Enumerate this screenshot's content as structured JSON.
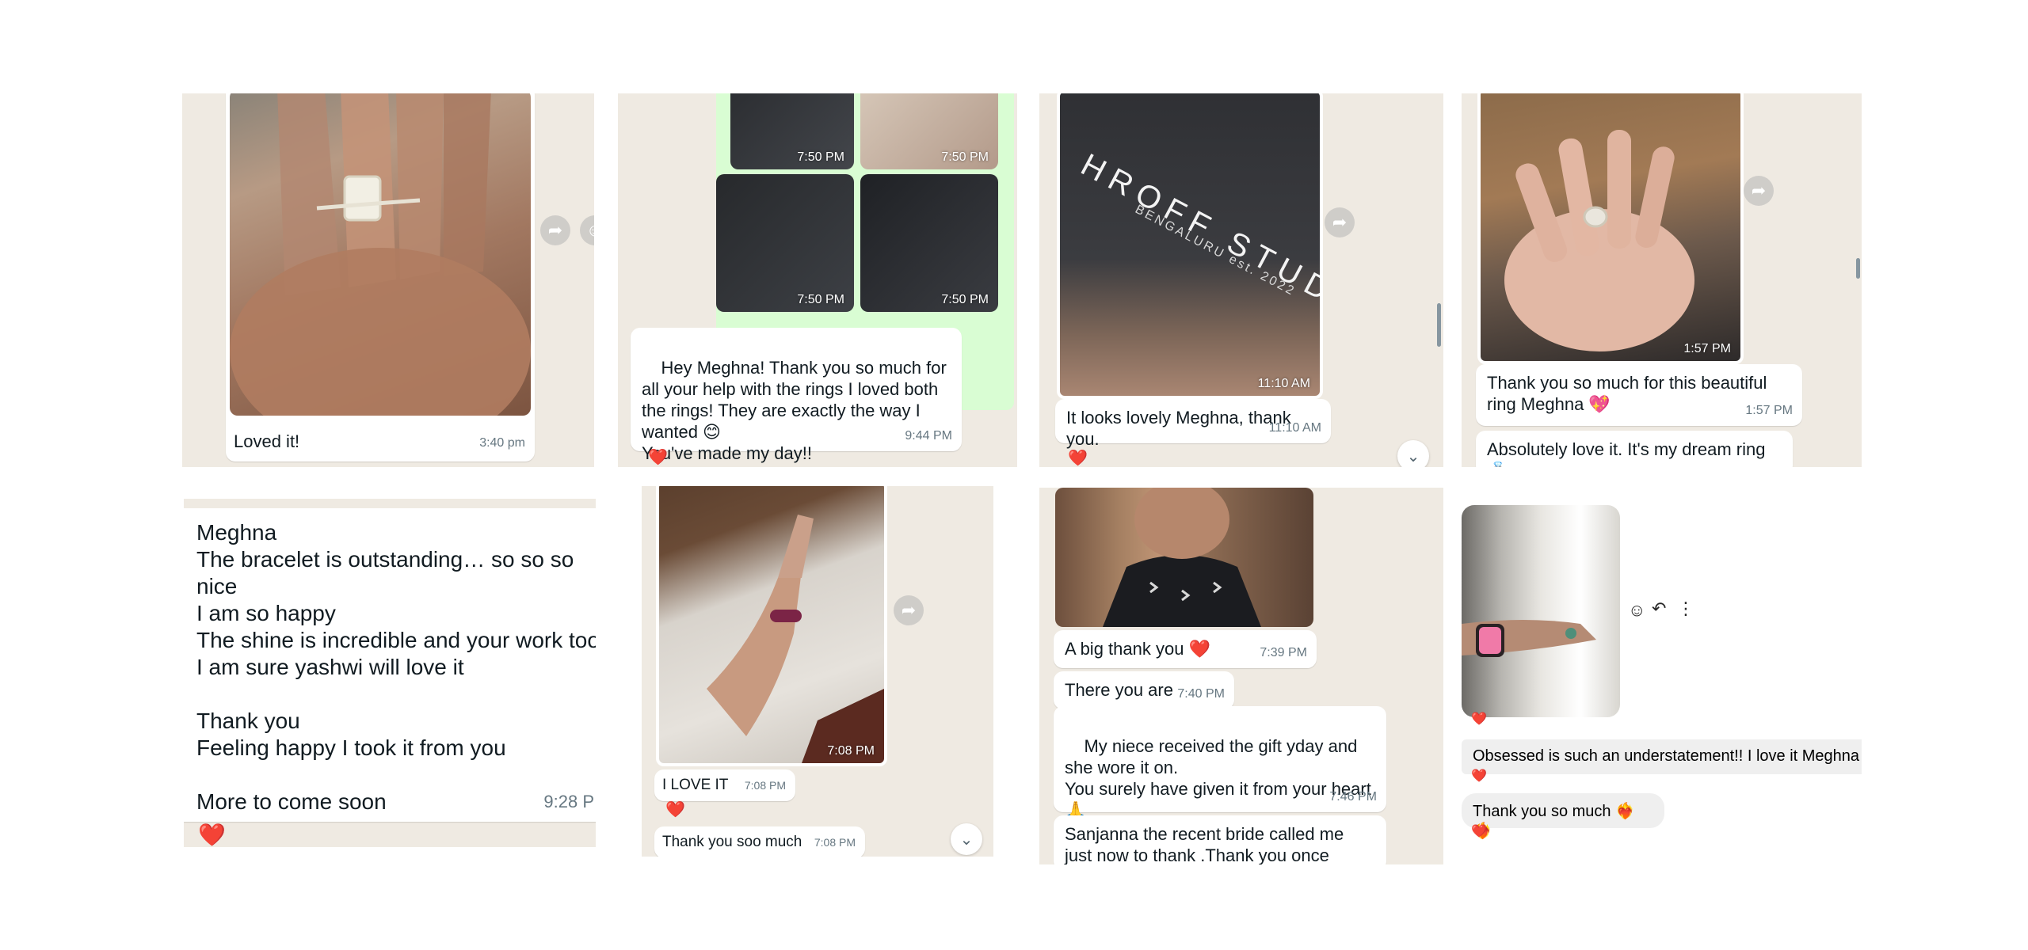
{
  "colors": {
    "chat_bg": "#efeae2",
    "bubble": "#ffffff",
    "timestamp": "#667781",
    "heart": "#e0245e",
    "ig_bubble": "#efefef"
  },
  "panel1": {
    "caption": "Loved it!",
    "time": "3:40 pm"
  },
  "panel2": {
    "photo_times": [
      "7:50 PM",
      "7:50 PM",
      "7:50 PM",
      "7:50 PM"
    ],
    "message": "Hey Meghna! Thank you so much for all your help with the rings I loved both the rings! They are exactly the way I wanted 😊\nYou've made my day!!",
    "time": "9:44 PM",
    "reaction": "❤️"
  },
  "panel3": {
    "photo_time": "11:10 AM",
    "box_text": "HROFF STUDIO",
    "box_sub": "BENGALURU est. 2022",
    "message": "It looks lovely Meghna, thank you.",
    "time": "11:10 AM",
    "reaction": "❤️"
  },
  "panel4": {
    "photo_time": "1:57 PM",
    "message1": "Thank you so much for this beautiful ring Meghna 💖",
    "time1": "1:57 PM",
    "message2": "Absolutely love it. It's my dream ring 💍"
  },
  "panel5": {
    "lines": [
      "Meghna",
      "The bracelet is outstanding… so so so nice",
      "I am so happy",
      "The shine is incredible and your work too",
      "I am sure yashwi will love it",
      "",
      "Thank you",
      "Feeling happy I took it from you",
      "",
      "More to come soon"
    ],
    "time": "9:28 P",
    "reaction": "❤️"
  },
  "panel6": {
    "photo_time": "7:08 PM",
    "message1": "I LOVE IT",
    "time1": "7:08 PM",
    "reaction": "❤️",
    "message2": "Thank you soo much",
    "time2": "7:08 PM"
  },
  "panel7": {
    "message1": "A big thank you ❤️",
    "time1": "7:39 PM",
    "message2": "There you are",
    "time2": "7:40 PM",
    "message3": "My niece received the gift yday and she wore it on.\nYou surely have given it from your heart 🙏",
    "time3": "7:46 PM",
    "message4": "Sanjanna the recent bride called me just now to thank .Thank you once again."
  },
  "panel8": {
    "message1": "Obsessed is such an understatement!! I love it Meghna",
    "message2": "Thank you so much ❤️‍🔥❤️‍🔥",
    "reaction": "❤️"
  }
}
